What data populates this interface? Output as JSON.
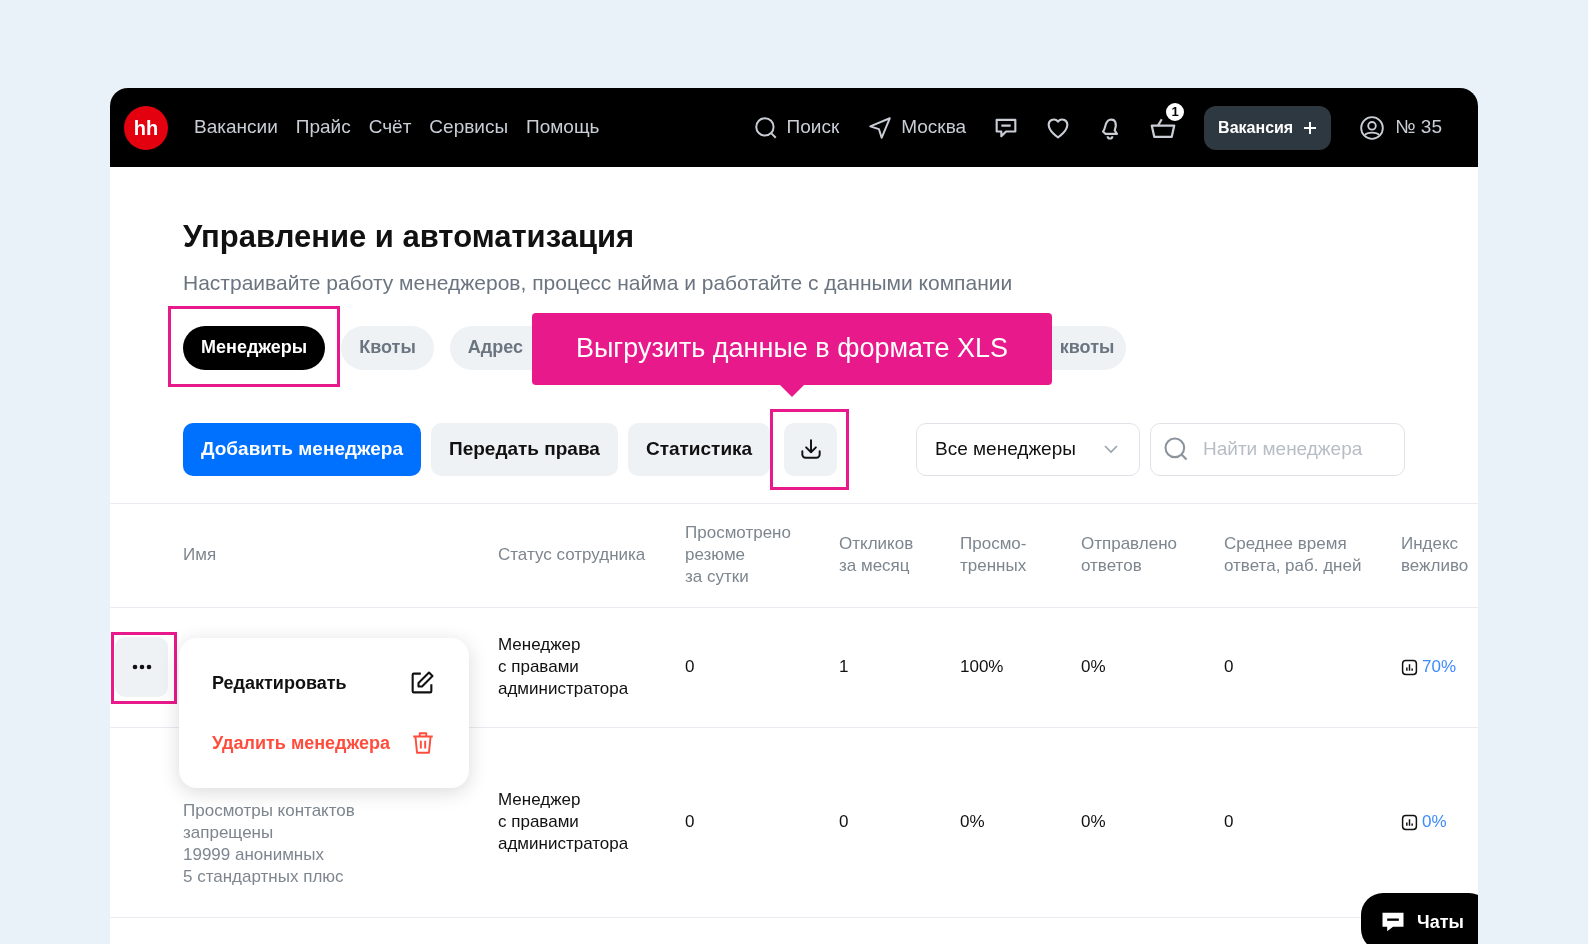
{
  "navbar": {
    "logo": "hh",
    "links": [
      "Вакансии",
      "Прайс",
      "Счёт",
      "Сервисы",
      "Помощь"
    ],
    "search": "Поиск",
    "city": "Москва",
    "cart_count": "1",
    "vacancy_button": "Вакансия",
    "account": "№ 35"
  },
  "page": {
    "title": "Управление и автоматизация",
    "subtitle": "Настраивайте работу менеджеров, процесс найма и работайте с данными компании"
  },
  "tabs": [
    {
      "label": "Менеджеры",
      "selected": true,
      "highlighted": true
    },
    {
      "label": "Квоты",
      "selected": false,
      "highlighted": false
    },
    {
      "label": "Адрес",
      "selected": false,
      "highlighted": false
    },
    {
      "label": "квоты",
      "selected": false,
      "highlighted": false
    }
  ],
  "tooltip": "Выгрузить данные в формате XLS",
  "actions": [
    {
      "kind": "primary",
      "label": "Добавить менеджера"
    },
    {
      "kind": "secondary",
      "label": "Передать права"
    },
    {
      "kind": "secondary",
      "label": "Статистика"
    },
    {
      "kind": "download",
      "highlighted": true
    }
  ],
  "filter": "Все менеджеры",
  "search": {
    "placeholder": "Найти менеджера"
  },
  "table": {
    "columns": [
      "Имя",
      "Статус сотрудника",
      "Просмотрено\nрезюме\nза сутки",
      "Откликов\nза месяц",
      "Просмо-\nтренных",
      "Отправлено\nответов",
      "Среднее время\nответа, раб. дней",
      "Индекс\nвежливо"
    ],
    "rows": [
      {
        "menu_open": true,
        "info": [],
        "status": "Менеджер\nс правами\nадминистратора",
        "values": [
          "0",
          "1",
          "100%",
          "0%",
          "0"
        ],
        "index": "70%"
      },
      {
        "menu_open": false,
        "info": [
          "Просмотры контактов\nзапрещены",
          "19999 анонимных",
          "5 стандартных плюс"
        ],
        "status": "Менеджер\nс правами\nадминистратора",
        "values": [
          "0",
          "0",
          "0%",
          "0%",
          "0"
        ],
        "index": "0%"
      }
    ]
  },
  "row_menu": [
    {
      "kind": "edit",
      "label": "Редактировать"
    },
    {
      "kind": "delete",
      "label": "Удалить менеджера"
    }
  ],
  "chat_button": "Чаты"
}
